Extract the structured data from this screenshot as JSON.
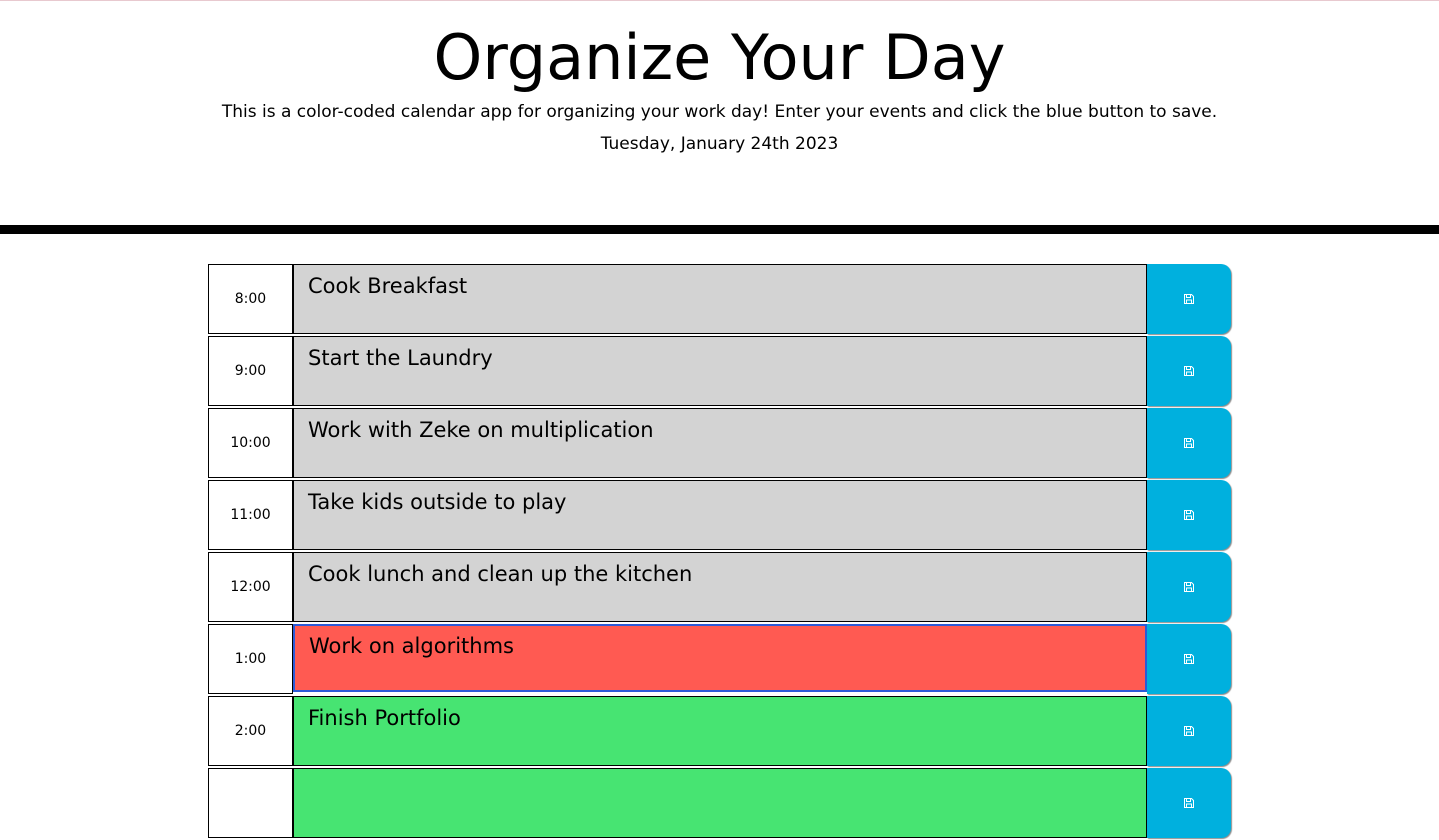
{
  "header": {
    "title": "Organize Your Day",
    "lead": "This is a color-coded calendar app for organizing your work day! Enter your events and click the blue button to save.",
    "current_day": "Tuesday, January 24th 2023"
  },
  "colors": {
    "past": "#d3d3d3",
    "present": "#ff5a52",
    "future": "#47e472",
    "save_button": "#00b0de"
  },
  "time_blocks": [
    {
      "hour": "8:00",
      "text": "Cook Breakfast",
      "state": "past",
      "icon": "save-icon"
    },
    {
      "hour": "9:00",
      "text": "Start the Laundry",
      "state": "past",
      "icon": "save-icon"
    },
    {
      "hour": "10:00",
      "text": "Work with Zeke on multiplication",
      "state": "past",
      "icon": "save-icon"
    },
    {
      "hour": "11:00",
      "text": "Take kids outside to play",
      "state": "past",
      "icon": "save-icon"
    },
    {
      "hour": "12:00",
      "text": "Cook lunch and clean up the kitchen",
      "state": "past",
      "icon": "save-icon"
    },
    {
      "hour": "1:00",
      "text": "Work on algorithms",
      "state": "present",
      "icon": "save-icon"
    },
    {
      "hour": "2:00",
      "text": "Finish Portfolio",
      "state": "future",
      "icon": "save-icon"
    },
    {
      "hour": "",
      "text": "",
      "state": "future",
      "icon": "save-icon"
    }
  ]
}
